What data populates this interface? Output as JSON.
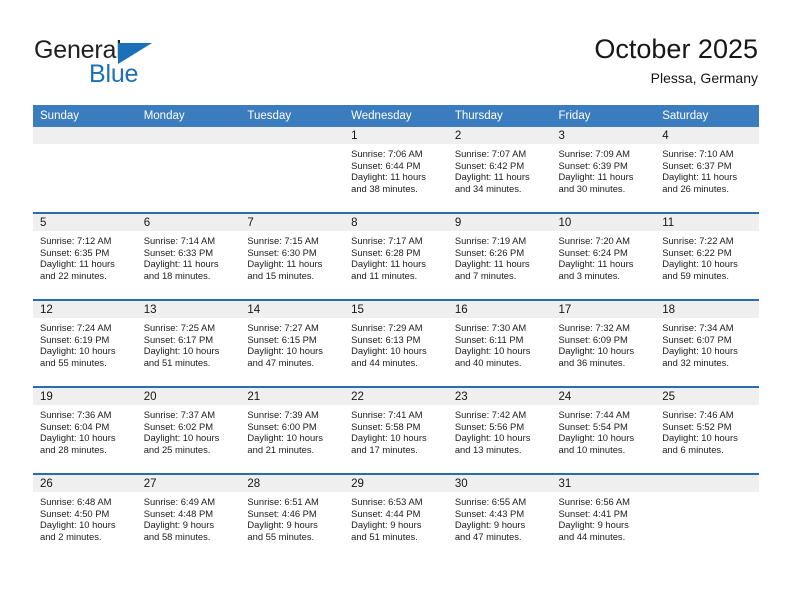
{
  "brand": {
    "name_top": "General",
    "name_bottom": "Blue",
    "accent_color": "#1b70b8",
    "flag_icon": "triangle-flag-icon"
  },
  "header": {
    "title": "October 2025",
    "location": "Plessa, Germany"
  },
  "theme": {
    "header_bar_color": "#3a7cbe",
    "week_divider_color": "#2b6cad",
    "daynum_band_color": "#efefef",
    "text_color": "#1c1c1c"
  },
  "weekday_headers": [
    "Sunday",
    "Monday",
    "Tuesday",
    "Wednesday",
    "Thursday",
    "Friday",
    "Saturday"
  ],
  "weeks": [
    [
      {
        "day": "",
        "blank": true,
        "sunrise": "",
        "sunset": "",
        "daylight_l1": "",
        "daylight_l2": ""
      },
      {
        "day": "",
        "blank": true,
        "sunrise": "",
        "sunset": "",
        "daylight_l1": "",
        "daylight_l2": ""
      },
      {
        "day": "",
        "blank": true,
        "sunrise": "",
        "sunset": "",
        "daylight_l1": "",
        "daylight_l2": ""
      },
      {
        "day": "1",
        "blank": false,
        "sunrise": "Sunrise: 7:06 AM",
        "sunset": "Sunset: 6:44 PM",
        "daylight_l1": "Daylight: 11 hours",
        "daylight_l2": "and 38 minutes."
      },
      {
        "day": "2",
        "blank": false,
        "sunrise": "Sunrise: 7:07 AM",
        "sunset": "Sunset: 6:42 PM",
        "daylight_l1": "Daylight: 11 hours",
        "daylight_l2": "and 34 minutes."
      },
      {
        "day": "3",
        "blank": false,
        "sunrise": "Sunrise: 7:09 AM",
        "sunset": "Sunset: 6:39 PM",
        "daylight_l1": "Daylight: 11 hours",
        "daylight_l2": "and 30 minutes."
      },
      {
        "day": "4",
        "blank": false,
        "sunrise": "Sunrise: 7:10 AM",
        "sunset": "Sunset: 6:37 PM",
        "daylight_l1": "Daylight: 11 hours",
        "daylight_l2": "and 26 minutes."
      }
    ],
    [
      {
        "day": "5",
        "blank": false,
        "sunrise": "Sunrise: 7:12 AM",
        "sunset": "Sunset: 6:35 PM",
        "daylight_l1": "Daylight: 11 hours",
        "daylight_l2": "and 22 minutes."
      },
      {
        "day": "6",
        "blank": false,
        "sunrise": "Sunrise: 7:14 AM",
        "sunset": "Sunset: 6:33 PM",
        "daylight_l1": "Daylight: 11 hours",
        "daylight_l2": "and 18 minutes."
      },
      {
        "day": "7",
        "blank": false,
        "sunrise": "Sunrise: 7:15 AM",
        "sunset": "Sunset: 6:30 PM",
        "daylight_l1": "Daylight: 11 hours",
        "daylight_l2": "and 15 minutes."
      },
      {
        "day": "8",
        "blank": false,
        "sunrise": "Sunrise: 7:17 AM",
        "sunset": "Sunset: 6:28 PM",
        "daylight_l1": "Daylight: 11 hours",
        "daylight_l2": "and 11 minutes."
      },
      {
        "day": "9",
        "blank": false,
        "sunrise": "Sunrise: 7:19 AM",
        "sunset": "Sunset: 6:26 PM",
        "daylight_l1": "Daylight: 11 hours",
        "daylight_l2": "and 7 minutes."
      },
      {
        "day": "10",
        "blank": false,
        "sunrise": "Sunrise: 7:20 AM",
        "sunset": "Sunset: 6:24 PM",
        "daylight_l1": "Daylight: 11 hours",
        "daylight_l2": "and 3 minutes."
      },
      {
        "day": "11",
        "blank": false,
        "sunrise": "Sunrise: 7:22 AM",
        "sunset": "Sunset: 6:22 PM",
        "daylight_l1": "Daylight: 10 hours",
        "daylight_l2": "and 59 minutes."
      }
    ],
    [
      {
        "day": "12",
        "blank": false,
        "sunrise": "Sunrise: 7:24 AM",
        "sunset": "Sunset: 6:19 PM",
        "daylight_l1": "Daylight: 10 hours",
        "daylight_l2": "and 55 minutes."
      },
      {
        "day": "13",
        "blank": false,
        "sunrise": "Sunrise: 7:25 AM",
        "sunset": "Sunset: 6:17 PM",
        "daylight_l1": "Daylight: 10 hours",
        "daylight_l2": "and 51 minutes."
      },
      {
        "day": "14",
        "blank": false,
        "sunrise": "Sunrise: 7:27 AM",
        "sunset": "Sunset: 6:15 PM",
        "daylight_l1": "Daylight: 10 hours",
        "daylight_l2": "and 47 minutes."
      },
      {
        "day": "15",
        "blank": false,
        "sunrise": "Sunrise: 7:29 AM",
        "sunset": "Sunset: 6:13 PM",
        "daylight_l1": "Daylight: 10 hours",
        "daylight_l2": "and 44 minutes."
      },
      {
        "day": "16",
        "blank": false,
        "sunrise": "Sunrise: 7:30 AM",
        "sunset": "Sunset: 6:11 PM",
        "daylight_l1": "Daylight: 10 hours",
        "daylight_l2": "and 40 minutes."
      },
      {
        "day": "17",
        "blank": false,
        "sunrise": "Sunrise: 7:32 AM",
        "sunset": "Sunset: 6:09 PM",
        "daylight_l1": "Daylight: 10 hours",
        "daylight_l2": "and 36 minutes."
      },
      {
        "day": "18",
        "blank": false,
        "sunrise": "Sunrise: 7:34 AM",
        "sunset": "Sunset: 6:07 PM",
        "daylight_l1": "Daylight: 10 hours",
        "daylight_l2": "and 32 minutes."
      }
    ],
    [
      {
        "day": "19",
        "blank": false,
        "sunrise": "Sunrise: 7:36 AM",
        "sunset": "Sunset: 6:04 PM",
        "daylight_l1": "Daylight: 10 hours",
        "daylight_l2": "and 28 minutes."
      },
      {
        "day": "20",
        "blank": false,
        "sunrise": "Sunrise: 7:37 AM",
        "sunset": "Sunset: 6:02 PM",
        "daylight_l1": "Daylight: 10 hours",
        "daylight_l2": "and 25 minutes."
      },
      {
        "day": "21",
        "blank": false,
        "sunrise": "Sunrise: 7:39 AM",
        "sunset": "Sunset: 6:00 PM",
        "daylight_l1": "Daylight: 10 hours",
        "daylight_l2": "and 21 minutes."
      },
      {
        "day": "22",
        "blank": false,
        "sunrise": "Sunrise: 7:41 AM",
        "sunset": "Sunset: 5:58 PM",
        "daylight_l1": "Daylight: 10 hours",
        "daylight_l2": "and 17 minutes."
      },
      {
        "day": "23",
        "blank": false,
        "sunrise": "Sunrise: 7:42 AM",
        "sunset": "Sunset: 5:56 PM",
        "daylight_l1": "Daylight: 10 hours",
        "daylight_l2": "and 13 minutes."
      },
      {
        "day": "24",
        "blank": false,
        "sunrise": "Sunrise: 7:44 AM",
        "sunset": "Sunset: 5:54 PM",
        "daylight_l1": "Daylight: 10 hours",
        "daylight_l2": "and 10 minutes."
      },
      {
        "day": "25",
        "blank": false,
        "sunrise": "Sunrise: 7:46 AM",
        "sunset": "Sunset: 5:52 PM",
        "daylight_l1": "Daylight: 10 hours",
        "daylight_l2": "and 6 minutes."
      }
    ],
    [
      {
        "day": "26",
        "blank": false,
        "sunrise": "Sunrise: 6:48 AM",
        "sunset": "Sunset: 4:50 PM",
        "daylight_l1": "Daylight: 10 hours",
        "daylight_l2": "and 2 minutes."
      },
      {
        "day": "27",
        "blank": false,
        "sunrise": "Sunrise: 6:49 AM",
        "sunset": "Sunset: 4:48 PM",
        "daylight_l1": "Daylight: 9 hours",
        "daylight_l2": "and 58 minutes."
      },
      {
        "day": "28",
        "blank": false,
        "sunrise": "Sunrise: 6:51 AM",
        "sunset": "Sunset: 4:46 PM",
        "daylight_l1": "Daylight: 9 hours",
        "daylight_l2": "and 55 minutes."
      },
      {
        "day": "29",
        "blank": false,
        "sunrise": "Sunrise: 6:53 AM",
        "sunset": "Sunset: 4:44 PM",
        "daylight_l1": "Daylight: 9 hours",
        "daylight_l2": "and 51 minutes."
      },
      {
        "day": "30",
        "blank": false,
        "sunrise": "Sunrise: 6:55 AM",
        "sunset": "Sunset: 4:43 PM",
        "daylight_l1": "Daylight: 9 hours",
        "daylight_l2": "and 47 minutes."
      },
      {
        "day": "31",
        "blank": false,
        "sunrise": "Sunrise: 6:56 AM",
        "sunset": "Sunset: 4:41 PM",
        "daylight_l1": "Daylight: 9 hours",
        "daylight_l2": "and 44 minutes."
      },
      {
        "day": "",
        "blank": true,
        "sunrise": "",
        "sunset": "",
        "daylight_l1": "",
        "daylight_l2": ""
      }
    ]
  ]
}
